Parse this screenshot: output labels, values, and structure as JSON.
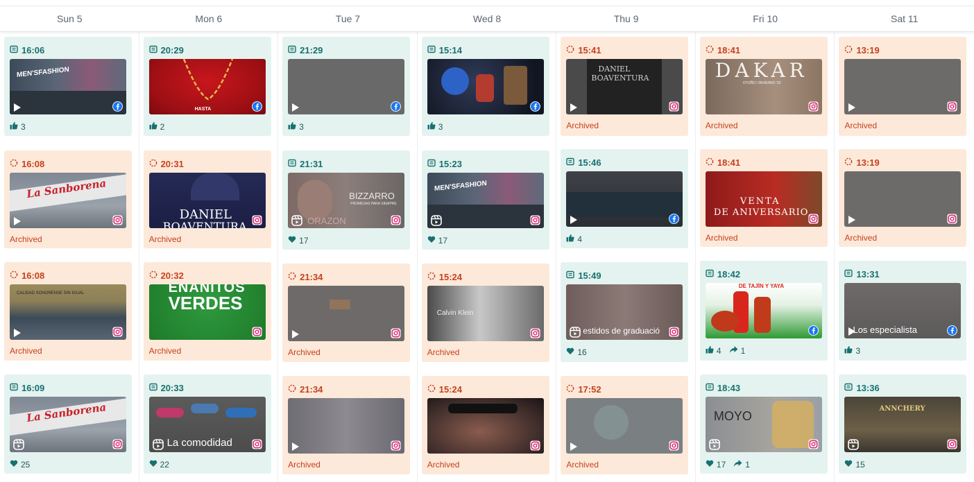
{
  "days": [
    "Sun 5",
    "Mon 6",
    "Tue 7",
    "Wed 8",
    "Thu 9",
    "Fri 10",
    "Sat 11"
  ],
  "archived_label": "Archived",
  "colors": {
    "published_bg": "#e4f3ef",
    "archived_bg": "#fde9da",
    "published_text": "#177071",
    "archived_text": "#c6401c"
  },
  "cards": {
    "c0r0": {
      "time": "16:06",
      "like": "3"
    },
    "c0r1": {
      "time": "16:08"
    },
    "c0r2": {
      "time": "16:08"
    },
    "c0r3": {
      "time": "16:09",
      "heart": "25"
    },
    "c1r0": {
      "time": "20:29",
      "like": "2"
    },
    "c1r1": {
      "time": "20:31"
    },
    "c1r2": {
      "time": "20:32"
    },
    "c1r3": {
      "time": "20:33",
      "heart": "22"
    },
    "c2r0": {
      "time": "21:29",
      "like": "3"
    },
    "c2r1": {
      "time": "21:31",
      "heart": "17"
    },
    "c2r2": {
      "time": "21:34"
    },
    "c2r3": {
      "time": "21:34"
    },
    "c3r0": {
      "time": "15:14",
      "like": "3"
    },
    "c3r1": {
      "time": "15:23",
      "heart": "17"
    },
    "c3r2": {
      "time": "15:24"
    },
    "c3r3": {
      "time": "15:24"
    },
    "c4r0": {
      "time": "15:41"
    },
    "c4r1": {
      "time": "15:46",
      "like": "4"
    },
    "c4r2": {
      "time": "15:49",
      "heart": "16"
    },
    "c4r3": {
      "time": "17:52"
    },
    "c5r0": {
      "time": "18:41"
    },
    "c5r1": {
      "time": "18:41"
    },
    "c5r2": {
      "time": "18:42",
      "like": "4",
      "share": "1"
    },
    "c5r3": {
      "time": "18:43",
      "heart": "17",
      "share": "1"
    },
    "c6r0": {
      "time": "13:19"
    },
    "c6r1": {
      "time": "13:19"
    },
    "c6r2": {
      "time": "13:31",
      "like": "3"
    },
    "c6r3": {
      "time": "13:36",
      "heart": "15"
    }
  },
  "thumb_texts": {
    "c0r0": "MEN'SFASHION",
    "c0r1": "La Sanborena",
    "c0r2": "CALIDAD SONORENSE SIN IGUAL",
    "c0r3": "La Sanborena",
    "c1r1_a": "DANIEL",
    "c1r1_b": "BOAVENTURA",
    "c1r2_a": "ENANITOS",
    "c1r2_b": "VERDES",
    "c1r3": "La comodidad",
    "c1r0": "HASTA",
    "c2r1_a": "BIZZARRO",
    "c2r1_b": "PROMESAS PARA SIEMPRE",
    "c2r1_c": "ORAZON",
    "c3r1": "MEN'SFASHION",
    "c3r2": "Calvin Klein",
    "c4r0_a": "DANIEL",
    "c4r0_b": "BOAVENTURA",
    "c4r2": "estidos de graduació",
    "c5r0_a": "DAKAR",
    "c5r0_b": "OTOÑO / INVIERNO '23",
    "c5r1_a": "VENTA",
    "c5r1_b": "DE ANIVERSARIO",
    "c5r2": "DE TAJÍN Y YAYA",
    "c5r3": "MOYO",
    "c6r2": "Los especialista",
    "c6r3": "ANNCHERY"
  }
}
